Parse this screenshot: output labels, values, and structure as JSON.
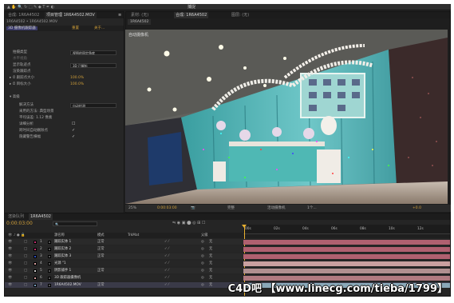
{
  "toolbar": {
    "comp_tab": "合成: 1R6A4502",
    "project_tab": "项目管理 1R6A4502.MOV",
    "snap_label": "捕捉"
  },
  "effect_controls": {
    "path": "1R6A4502 • 1R6A4502.MOV",
    "fx_name": "3D 摄像机跟踪器",
    "reset": "重置",
    "about": "关于...",
    "analysis_mode_label": "拍摄类型",
    "analysis_mode_value": "视图的固定角度",
    "focal_label": "水平视角",
    "show_points_label": "显示轨迹点",
    "show_points_value": "3D 已解析",
    "render_points_label": "渲染跟踪点",
    "point_size_label": "跟踪点大小",
    "point_size_value": "100.0%",
    "target_size_label": "目标大小",
    "target_size_value": "100.0%",
    "advanced_label": "高级",
    "solve_method_label": "解决方法",
    "solve_method_value": "自动检测",
    "method_used_label": "采用的方法: 典型场景",
    "avg_error_label": "平均误差: 1.12 像素",
    "detailed_label": "详细分析",
    "auto_delete_label": "跨时间自动删除点",
    "hide_warning_label": "隐藏警告横幅"
  },
  "viewer": {
    "tab_footage": "素材: (无)",
    "tab_comp": "合成: 1R6A4502",
    "tab_layer": "图层: (无)",
    "comp_label": "1R6A4502",
    "overlay_label": "自动摄像机",
    "zoom": "25%",
    "timecode": "0:00:03:00",
    "quality": "完整",
    "camera": "活动摄像机",
    "views": "1个...",
    "exposure": "+0.0"
  },
  "timeline": {
    "tab_render": "渲染队列",
    "tab_comp": "1R6A4502",
    "timecode": "0:00:03:00",
    "search_placeholder": "",
    "col_name": "源名称",
    "col_mode": "模式",
    "col_trkmat": "TrkMat",
    "col_parent": "父级",
    "ruler": [
      "00s",
      "02s",
      "04s",
      "06s",
      "08s",
      "10s",
      "12s"
    ],
    "layers": [
      {
        "num": "1",
        "name": "跟踪实体 1",
        "mode": "正常",
        "color": "#c03070",
        "bar": "#b06070"
      },
      {
        "num": "2",
        "name": "跟踪实体 2",
        "mode": "正常",
        "color": "#c03070",
        "bar": "#b06070"
      },
      {
        "num": "3",
        "name": "跟踪实体 3",
        "mode": "正常",
        "color": "#3050c0",
        "bar": "#b06070"
      },
      {
        "num": "4",
        "name": "光源 \"1",
        "mode": "",
        "color": "#d9a0a0",
        "bar": "#c9a0a0"
      },
      {
        "num": "5",
        "name": "阴影捕手 1",
        "mode": "正常",
        "color": "#cfcfcf",
        "bar": "#b09090"
      },
      {
        "num": "6",
        "name": "3D 跟踪器摄像机",
        "mode": "",
        "color": "#d9a0a0",
        "bar": "#b07a80"
      },
      {
        "num": "7",
        "name": "1R6A4502.MOV",
        "mode": "正常",
        "color": "#7aa0c0",
        "bar": "#8aa8b8"
      }
    ],
    "parent_none": "无"
  },
  "watermark": "C4D吧 【www.linecg.com/tieba/1799】",
  "colors": {
    "accent": "#d09f3a",
    "background": "#232323",
    "playhead": "#e8b030"
  }
}
